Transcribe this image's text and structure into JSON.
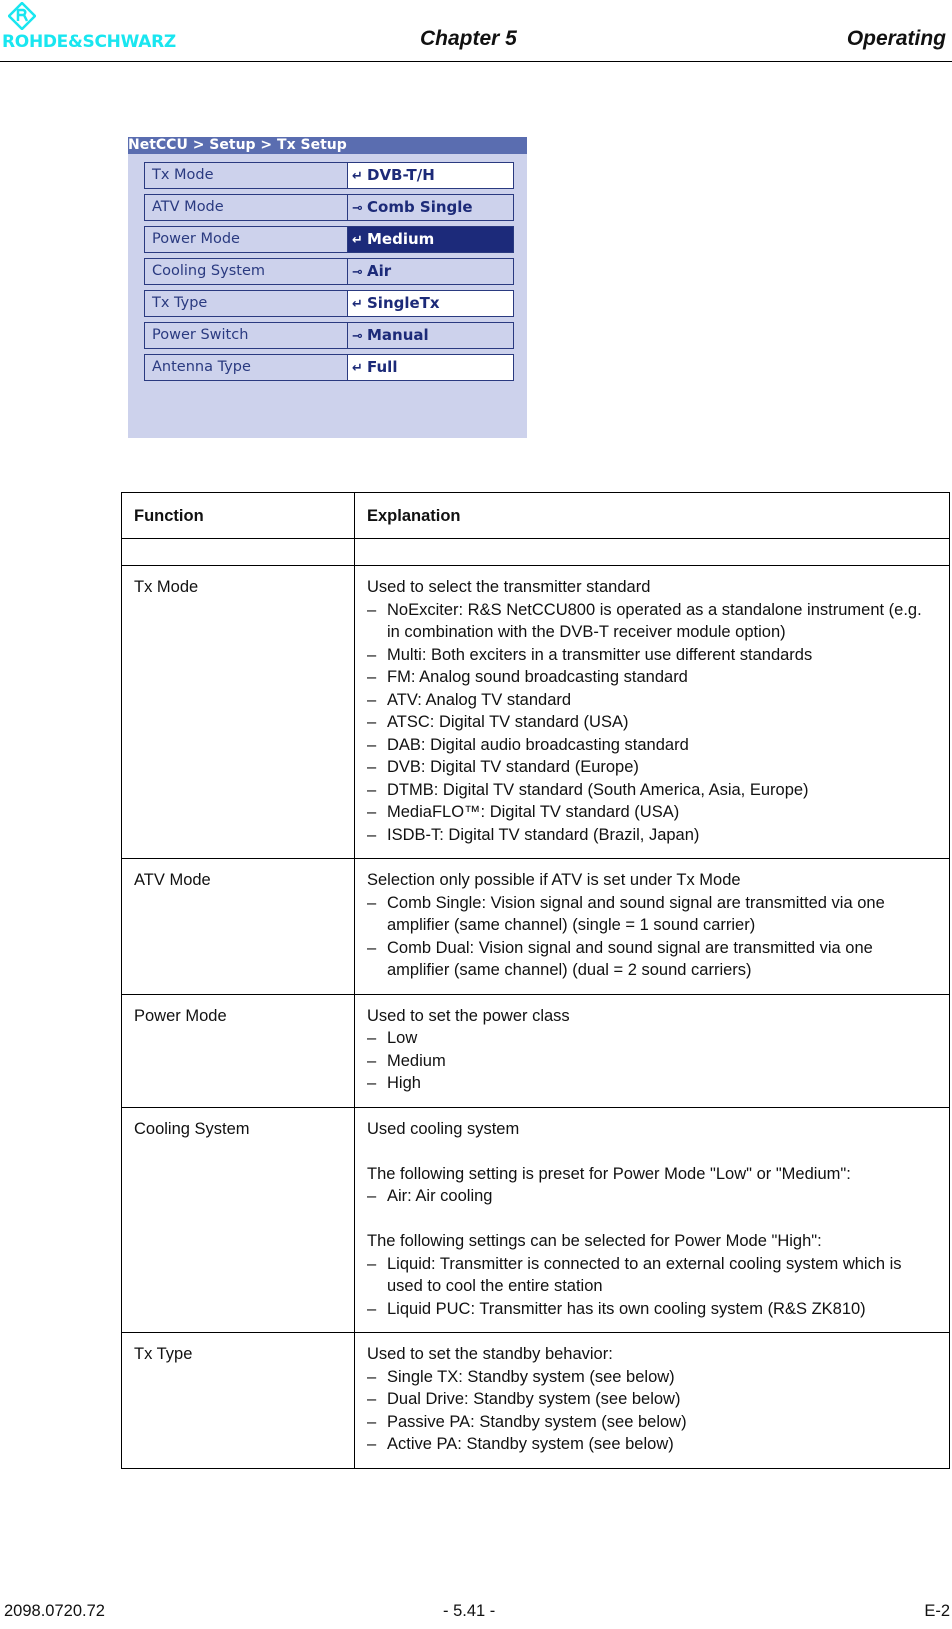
{
  "header": {
    "logo_text": "ROHDE&SCHWARZ",
    "chapter": "Chapter 5",
    "section": "Operating",
    "brand_color": "#19e6f0"
  },
  "device_screen": {
    "breadcrumb": "NetCCU  > Setup > Tx Setup",
    "rows": [
      {
        "label": "Tx Mode",
        "value": "DVB-T/H",
        "icon": "enter-icon",
        "glyph": "↵",
        "style": "white"
      },
      {
        "label": "ATV Mode",
        "value": "Comb Single",
        "icon": "key-icon",
        "glyph": "⊸",
        "style": "blue"
      },
      {
        "label": "Power Mode",
        "value": "Medium",
        "icon": "enter-icon",
        "glyph": "↵",
        "style": "selected"
      },
      {
        "label": "Cooling System",
        "value": "Air",
        "icon": "key-icon",
        "glyph": "⊸",
        "style": "blue"
      },
      {
        "label": "Tx Type",
        "value": "SingleTx",
        "icon": "enter-icon",
        "glyph": "↵",
        "style": "white"
      },
      {
        "label": "Power Switch",
        "value": "Manual",
        "icon": "key-icon",
        "glyph": "⊸",
        "style": "blue"
      },
      {
        "label": "Antenna Type",
        "value": "Full",
        "icon": "enter-icon",
        "glyph": "↵",
        "style": "white"
      }
    ]
  },
  "table": {
    "headers": [
      "Function",
      "Explanation"
    ],
    "rows": [
      {
        "function": "Tx Mode",
        "lines": [
          {
            "t": "Used to select the transmitter standard"
          },
          {
            "d": "NoExciter: R&S NetCCU800 is operated as a standalone instrument (e.g. in combination with the DVB-T receiver module option)"
          },
          {
            "d": "Multi: Both exciters in a transmitter use different standards"
          },
          {
            "d": "FM: Analog sound broadcasting standard"
          },
          {
            "d": "ATV: Analog TV standard"
          },
          {
            "d": "ATSC: Digital TV standard (USA)"
          },
          {
            "d": "DAB: Digital audio broadcasting standard"
          },
          {
            "d": "DVB: Digital TV standard (Europe)"
          },
          {
            "d": "DTMB: Digital TV standard (South America, Asia, Europe)"
          },
          {
            "d": "MediaFLO™: Digital TV standard (USA)"
          },
          {
            "d": "ISDB-T: Digital TV standard (Brazil, Japan)"
          }
        ]
      },
      {
        "function": "ATV Mode",
        "lines": [
          {
            "t": "Selection only possible if ATV is set under Tx Mode"
          },
          {
            "d": "Comb Single: Vision signal and sound signal are transmitted via one amplifier (same channel) (single = 1 sound carrier)"
          },
          {
            "d": "Comb Dual: Vision signal and sound signal are transmitted via one amplifier (same channel) (dual = 2 sound carriers)"
          }
        ]
      },
      {
        "function": "Power Mode",
        "lines": [
          {
            "t": "Used to set the power class"
          },
          {
            "d": "Low"
          },
          {
            "d": "Medium"
          },
          {
            "d": "High"
          }
        ]
      },
      {
        "function": "Cooling System",
        "lines": [
          {
            "t": "Used cooling system"
          },
          {
            "b": ""
          },
          {
            "t": "The following setting is preset for Power Mode \"Low\" or \"Medium\":"
          },
          {
            "d": "Air: Air cooling"
          },
          {
            "b": ""
          },
          {
            "t": "The following settings can be selected for Power Mode \"High\":"
          },
          {
            "d": "Liquid: Transmitter is connected to an external cooling system which is used to cool the entire station"
          },
          {
            "d": "Liquid PUC: Transmitter has its own cooling system (R&S ZK810)"
          }
        ]
      },
      {
        "function": "Tx Type",
        "lines": [
          {
            "t": "Used to set the standby behavior:"
          },
          {
            "d": "Single TX: Standby system (see below)"
          },
          {
            "d": "Dual Drive: Standby system (see below)"
          },
          {
            "d": "Passive PA: Standby system (see below)"
          },
          {
            "d": "Active PA: Standby system (see below)"
          }
        ]
      }
    ]
  },
  "footer": {
    "doc_number": "2098.0720.72",
    "page": "- 5.41 -",
    "edition": "E-2"
  }
}
